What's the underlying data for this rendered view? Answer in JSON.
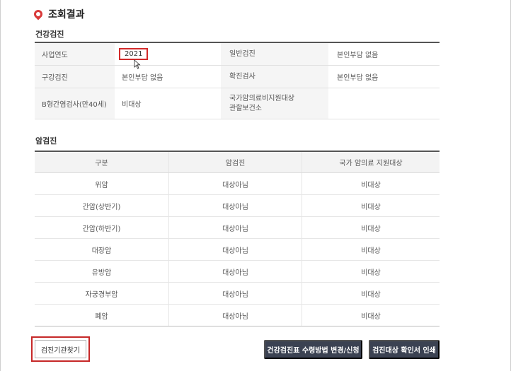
{
  "section_title": "조회결과",
  "checkup": {
    "title": "건강검진",
    "rows": [
      {
        "k1": "사업연도",
        "v1": "2021",
        "k2": "일반검진",
        "v2": "본인부담 없음"
      },
      {
        "k1": "구강검진",
        "v1": "본인부담 없음",
        "k2": "확진검사",
        "v2": "본인부담 없음"
      },
      {
        "k1": "B형간염검사(만40세)",
        "v1": "비대상",
        "k2": "국가암의료비지원대상\n관할보건소",
        "v2": ""
      }
    ]
  },
  "cancer": {
    "title": "암검진",
    "headers": [
      "구분",
      "암검진",
      "국가 암의료 지원대상"
    ],
    "rows": [
      [
        "위암",
        "대상아님",
        "비대상"
      ],
      [
        "간암(상반기)",
        "대상아님",
        "비대상"
      ],
      [
        "간암(하반기)",
        "대상아님",
        "비대상"
      ],
      [
        "대장암",
        "대상아님",
        "비대상"
      ],
      [
        "유방암",
        "대상아님",
        "비대상"
      ],
      [
        "자궁경부암",
        "대상아님",
        "비대상"
      ],
      [
        "폐암",
        "대상아님",
        "비대상"
      ]
    ]
  },
  "buttons": {
    "find_institution": "검진기관찾기",
    "change_receipt": "건강검진표 수령방법 변경/신청",
    "print_confirmation": "검진대상 확인서 인쇄"
  },
  "colors": {
    "accent_red": "#d32a2a",
    "dark_button": "#3b4252"
  }
}
